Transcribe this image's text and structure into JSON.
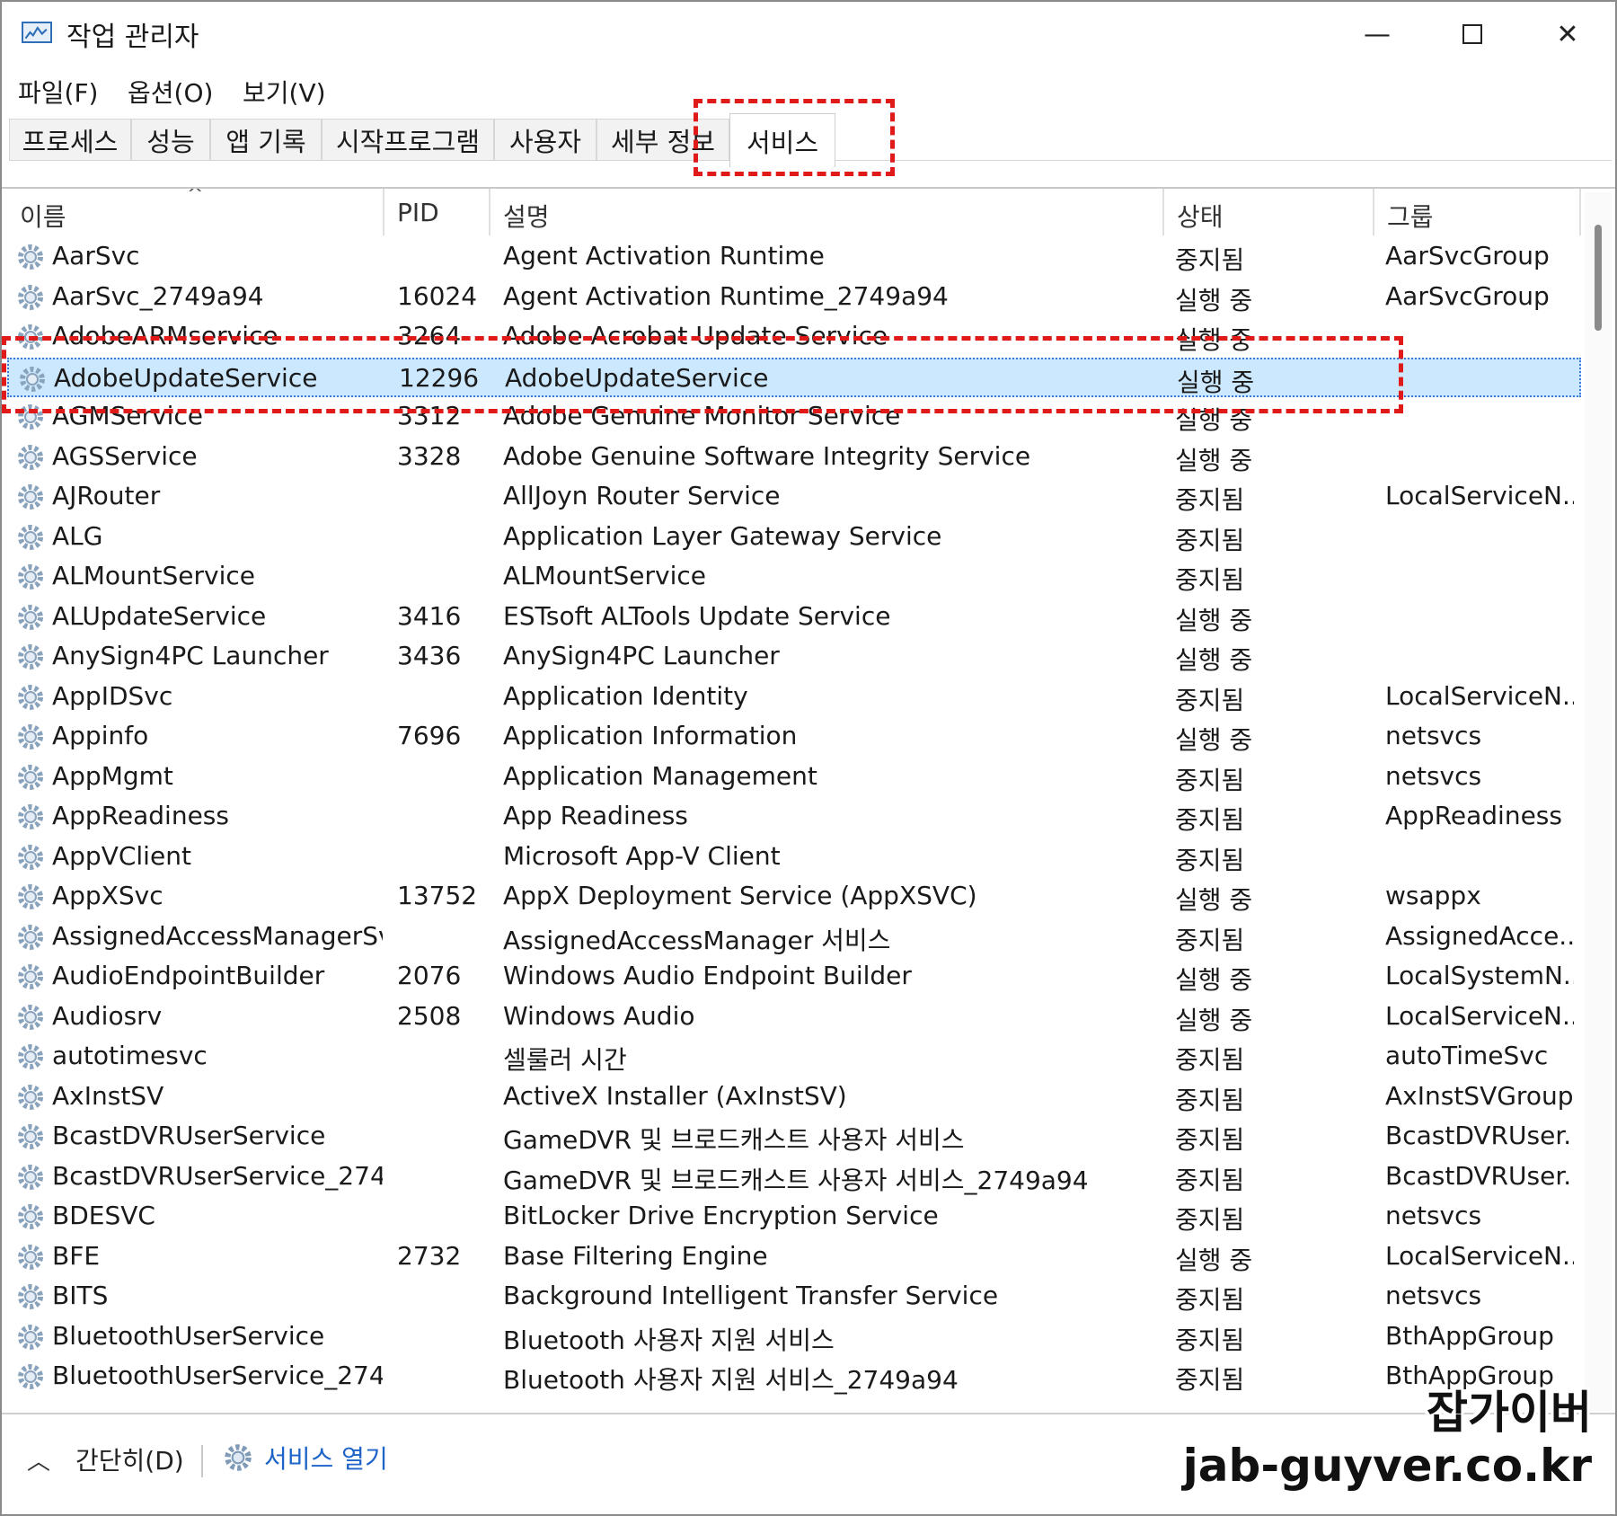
{
  "window": {
    "title": "작업 관리자"
  },
  "menu": [
    "파일(F)",
    "옵션(O)",
    "보기(V)"
  ],
  "tabs": [
    "프로세스",
    "성능",
    "앱 기록",
    "시작프로그램",
    "사용자",
    "세부 정보",
    "서비스"
  ],
  "active_tab": "서비스",
  "columns": {
    "name": "이름",
    "pid": "PID",
    "desc": "설명",
    "status": "상태",
    "group": "그룹"
  },
  "rows": [
    {
      "name": "AarSvc",
      "pid": "",
      "desc": "Agent Activation Runtime",
      "status": "중지됨",
      "group": "AarSvcGroup"
    },
    {
      "name": "AarSvc_2749a94",
      "pid": "16024",
      "desc": "Agent Activation Runtime_2749a94",
      "status": "실행 중",
      "group": "AarSvcGroup"
    },
    {
      "name": "AdobeARMservice",
      "pid": "3264",
      "desc": "Adobe Acrobat Update Service",
      "status": "실행 중",
      "group": ""
    },
    {
      "name": "AdobeUpdateService",
      "pid": "12296",
      "desc": "AdobeUpdateService",
      "status": "실행 중",
      "group": "",
      "selected": true
    },
    {
      "name": "AGMService",
      "pid": "3312",
      "desc": "Adobe Genuine Monitor Service",
      "status": "실행 중",
      "group": ""
    },
    {
      "name": "AGSService",
      "pid": "3328",
      "desc": "Adobe Genuine Software Integrity Service",
      "status": "실행 중",
      "group": ""
    },
    {
      "name": "AJRouter",
      "pid": "",
      "desc": "AllJoyn Router Service",
      "status": "중지됨",
      "group": "LocalServiceN..."
    },
    {
      "name": "ALG",
      "pid": "",
      "desc": "Application Layer Gateway Service",
      "status": "중지됨",
      "group": ""
    },
    {
      "name": "ALMountService",
      "pid": "",
      "desc": "ALMountService",
      "status": "중지됨",
      "group": ""
    },
    {
      "name": "ALUpdateService",
      "pid": "3416",
      "desc": "ESTsoft ALTools Update Service",
      "status": "실행 중",
      "group": ""
    },
    {
      "name": "AnySign4PC Launcher",
      "pid": "3436",
      "desc": "AnySign4PC Launcher",
      "status": "실행 중",
      "group": ""
    },
    {
      "name": "AppIDSvc",
      "pid": "",
      "desc": "Application Identity",
      "status": "중지됨",
      "group": "LocalServiceN..."
    },
    {
      "name": "Appinfo",
      "pid": "7696",
      "desc": "Application Information",
      "status": "실행 중",
      "group": "netsvcs"
    },
    {
      "name": "AppMgmt",
      "pid": "",
      "desc": "Application Management",
      "status": "중지됨",
      "group": "netsvcs"
    },
    {
      "name": "AppReadiness",
      "pid": "",
      "desc": "App Readiness",
      "status": "중지됨",
      "group": "AppReadiness"
    },
    {
      "name": "AppVClient",
      "pid": "",
      "desc": "Microsoft App-V Client",
      "status": "중지됨",
      "group": ""
    },
    {
      "name": "AppXSvc",
      "pid": "13752",
      "desc": "AppX Deployment Service (AppXSVC)",
      "status": "실행 중",
      "group": "wsappx"
    },
    {
      "name": "AssignedAccessManagerSvc",
      "pid": "",
      "desc": "AssignedAccessManager 서비스",
      "status": "중지됨",
      "group": "AssignedAcce..."
    },
    {
      "name": "AudioEndpointBuilder",
      "pid": "2076",
      "desc": "Windows Audio Endpoint Builder",
      "status": "실행 중",
      "group": "LocalSystemN..."
    },
    {
      "name": "Audiosrv",
      "pid": "2508",
      "desc": "Windows Audio",
      "status": "실행 중",
      "group": "LocalServiceN..."
    },
    {
      "name": "autotimesvc",
      "pid": "",
      "desc": "셀룰러 시간",
      "status": "중지됨",
      "group": "autoTimeSvc"
    },
    {
      "name": "AxInstSV",
      "pid": "",
      "desc": "ActiveX Installer (AxInstSV)",
      "status": "중지됨",
      "group": "AxInstSVGroup"
    },
    {
      "name": "BcastDVRUserService",
      "pid": "",
      "desc": "GameDVR 및 브로드캐스트 사용자 서비스",
      "status": "중지됨",
      "group": "BcastDVRUser..."
    },
    {
      "name": "BcastDVRUserService_274...",
      "pid": "",
      "desc": "GameDVR 및 브로드캐스트 사용자 서비스_2749a94",
      "status": "중지됨",
      "group": "BcastDVRUser..."
    },
    {
      "name": "BDESVC",
      "pid": "",
      "desc": "BitLocker Drive Encryption Service",
      "status": "중지됨",
      "group": "netsvcs"
    },
    {
      "name": "BFE",
      "pid": "2732",
      "desc": "Base Filtering Engine",
      "status": "실행 중",
      "group": "LocalServiceN..."
    },
    {
      "name": "BITS",
      "pid": "",
      "desc": "Background Intelligent Transfer Service",
      "status": "중지됨",
      "group": "netsvcs"
    },
    {
      "name": "BluetoothUserService",
      "pid": "",
      "desc": "Bluetooth 사용자 지원 서비스",
      "status": "중지됨",
      "group": "BthAppGroup"
    },
    {
      "name": "BluetoothUserService_274...",
      "pid": "",
      "desc": "Bluetooth 사용자 지원 서비스_2749a94",
      "status": "중지됨",
      "group": "BthAppGroup"
    }
  ],
  "footer": {
    "fewer_details": "간단히(D)",
    "open_services": "서비스 열기"
  },
  "watermark": {
    "line1": "잡가이버",
    "line2": "jab-guyver.co.kr"
  },
  "colors": {
    "selection": "#cce8ff",
    "link": "#1e64c8",
    "annotation": "#e01919"
  }
}
